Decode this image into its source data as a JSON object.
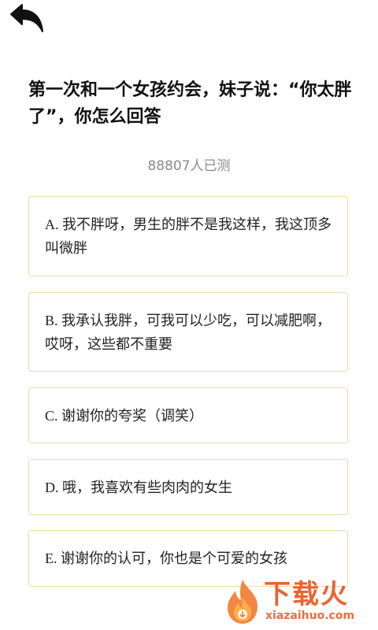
{
  "header": {
    "back_icon": "back-arrow-icon"
  },
  "question": {
    "text": "第一次和一个女孩约会，妹子说：“你太胖了”，你怎么回答"
  },
  "participants": {
    "text": "88807人已测"
  },
  "options": [
    {
      "label": "A. 我不胖呀，男生的胖不是我这样，我这顶多叫微胖"
    },
    {
      "label": "B. 我承认我胖，可我可以少吃，可以减肥啊，哎呀，这些都不重要"
    },
    {
      "label": "C. 谢谢你的夸奖（调笑）"
    },
    {
      "label": "D. 哦，我喜欢有些肉肉的女生"
    },
    {
      "label": "E. 谢谢你的认可，你也是个可爱的女孩"
    }
  ],
  "watermark": {
    "title": "下载火",
    "domain": "xiazaihuo.com",
    "icon": "flame-logo-icon"
  },
  "colors": {
    "option_border": "#f2d9a6",
    "question_text": "#111111",
    "count_text": "#8a8a8a",
    "watermark": "#e8541d"
  }
}
